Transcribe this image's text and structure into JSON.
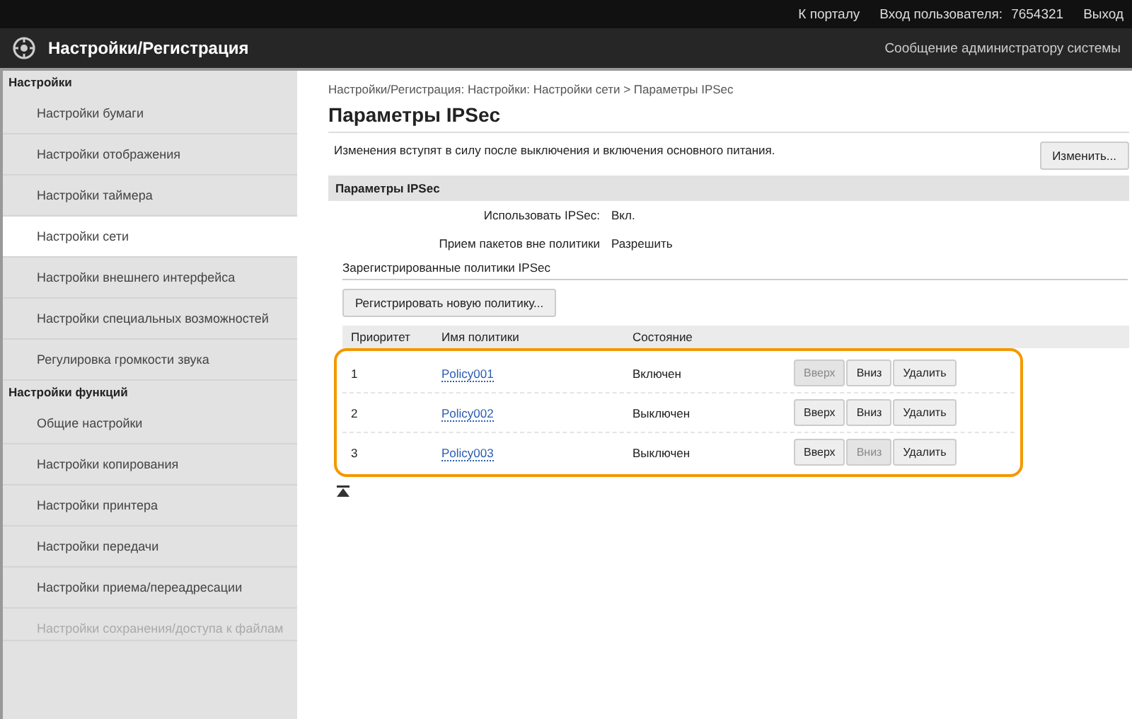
{
  "top_bar": {
    "portal_link": "К порталу",
    "user_label": "Вход пользователя:",
    "user_id": "7654321",
    "logout": "Выход"
  },
  "header": {
    "title": "Настройки/Регистрация",
    "admin_link": "Сообщение администратору системы"
  },
  "sidebar": {
    "sections": [
      {
        "title": "Настройки",
        "items": [
          {
            "label": "Настройки бумаги",
            "selected": false
          },
          {
            "label": "Настройки отображения",
            "selected": false
          },
          {
            "label": "Настройки таймера",
            "selected": false
          },
          {
            "label": "Настройки сети",
            "selected": true
          },
          {
            "label": "Настройки внешнего интерфейса",
            "selected": false
          },
          {
            "label": "Настройки специальных возможностей",
            "selected": false
          },
          {
            "label": "Регулировка громкости звука",
            "selected": false
          }
        ]
      },
      {
        "title": "Настройки функций",
        "items": [
          {
            "label": "Общие настройки",
            "selected": false
          },
          {
            "label": "Настройки копирования",
            "selected": false
          },
          {
            "label": "Настройки принтера",
            "selected": false
          },
          {
            "label": "Настройки передачи",
            "selected": false
          },
          {
            "label": "Настройки приема/переадресации",
            "selected": false
          },
          {
            "label": "Настройки сохранения/доступа к файлам",
            "selected": false
          }
        ]
      }
    ]
  },
  "breadcrumb": "Настройки/Регистрация: Настройки: Настройки сети > Параметры IPSec",
  "page_title": "Параметры IPSec",
  "notice": "Изменения вступят в силу после выключения и включения основного питания.",
  "edit_button": "Изменить...",
  "section_title": "Параметры IPSec",
  "settings": [
    {
      "label": "Использовать IPSec:",
      "value": "Вкл."
    },
    {
      "label": "Прием пакетов вне политики",
      "value": "Разрешить"
    }
  ],
  "policies_title": "Зарегистрированные политики IPSec",
  "register_button": "Регистрировать новую политику...",
  "table": {
    "columns": [
      "Приоритет",
      "Имя политики",
      "Состояние"
    ],
    "rows": [
      {
        "priority": "1",
        "name": "Policy001",
        "status": "Включен",
        "buttons": [
          {
            "label": "Вверх",
            "disabled": true
          },
          {
            "label": "Вниз",
            "disabled": false
          },
          {
            "label": "Удалить",
            "disabled": false
          }
        ]
      },
      {
        "priority": "2",
        "name": "Policy002",
        "status": "Выключен",
        "buttons": [
          {
            "label": "Вверх",
            "disabled": false
          },
          {
            "label": "Вниз",
            "disabled": false
          },
          {
            "label": "Удалить",
            "disabled": false
          }
        ]
      },
      {
        "priority": "3",
        "name": "Policy003",
        "status": "Выключен",
        "buttons": [
          {
            "label": "Вверх",
            "disabled": false
          },
          {
            "label": "Вниз",
            "disabled": true
          },
          {
            "label": "Удалить",
            "disabled": false
          }
        ]
      }
    ]
  }
}
